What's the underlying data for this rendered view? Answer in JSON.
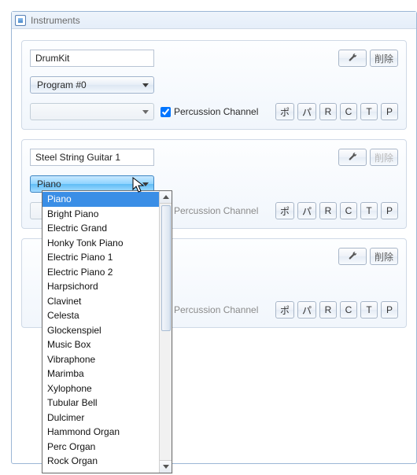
{
  "window": {
    "title": "Instruments"
  },
  "buttons": {
    "delete": "削除",
    "po": "ポ",
    "pa": "パ",
    "r": "R",
    "c": "C",
    "t": "T",
    "p": "P"
  },
  "labels": {
    "percussion_channel": "Percussion Channel"
  },
  "instruments": [
    {
      "name": "DrumKit",
      "program": "Program #0",
      "percussion_checked": true,
      "delete_enabled": true
    },
    {
      "name": "Steel String Guitar 1",
      "program": "Piano",
      "percussion_checked": false,
      "delete_enabled": false,
      "dropdown_open": true
    },
    {
      "name": "",
      "program": "",
      "percussion_checked": false,
      "delete_enabled": true
    }
  ],
  "program_options": [
    "Piano",
    "Bright Piano",
    "Electric Grand",
    "Honky Tonk Piano",
    "Electric Piano 1",
    "Electric Piano 2",
    "Harpsichord",
    "Clavinet",
    "Celesta",
    "Glockenspiel",
    "Music Box",
    "Vibraphone",
    "Marimba",
    "Xylophone",
    "Tubular Bell",
    "Dulcimer",
    "Hammond Organ",
    "Perc Organ",
    "Rock Organ"
  ],
  "program_selected_index": 0
}
